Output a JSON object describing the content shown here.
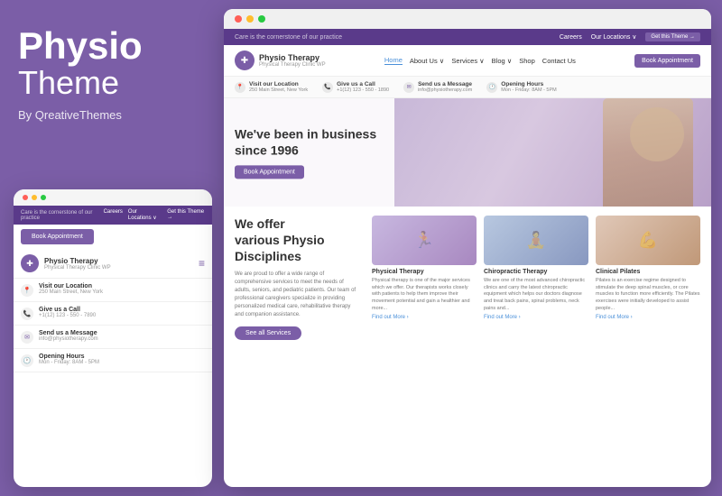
{
  "left": {
    "title_bold": "Physio",
    "title_light": "Theme",
    "subtitle": "By QreativeThemes"
  },
  "mobile": {
    "tagline": "Care is the cornerstone of our practice",
    "nav_links": [
      "Careers",
      "Our Locations ∨",
      "Get this Theme →"
    ],
    "book_btn": "Book Appointment",
    "brand_name": "Physio Therapy",
    "brand_sub": "Physical Therapy Clinic WP",
    "info_items": [
      {
        "label": "Visit our Location",
        "value": "250 Main Street, New York"
      },
      {
        "label": "Give us a Call",
        "value": "+1(12) 123 - 550 - 7890"
      },
      {
        "label": "Send us a Message",
        "value": "info@physiotherapy.com"
      },
      {
        "label": "Opening Hours",
        "value": "Mon - Friday: 8AM - 5PM"
      }
    ]
  },
  "desktop": {
    "top_nav": {
      "tagline": "Care is the cornerstone of our practice",
      "links": [
        "Careers",
        "Our Locations ∨",
        "Get this Theme →"
      ]
    },
    "header": {
      "brand_name": "Physio Therapy",
      "brand_sub": "Physical Therapy Clinic WP",
      "menu": [
        "Home",
        "About Us ∨",
        "Services ∨",
        "Blog ∨",
        "Shop",
        "Contact Us"
      ],
      "active": "Home",
      "book_btn": "Book Appointment"
    },
    "info_bar": [
      {
        "icon": "📍",
        "label": "Visit our Location",
        "value": "250 Main Street, New York"
      },
      {
        "icon": "📞",
        "label": "Give us a Call",
        "value": "+1(12) 123 - 550 - 1890"
      },
      {
        "icon": "✉",
        "label": "Send us a Message",
        "value": "info@physiotherapy.com"
      },
      {
        "icon": "🕐",
        "label": "Opening Hours",
        "value": "Mon - Friday: 8AM - 5PM"
      }
    ],
    "hero": {
      "headline_line1": "We've been in business",
      "headline_line2": "since 1996",
      "book_btn": "Book Appointment"
    },
    "offer_section": {
      "heading_line1": "We offer",
      "heading_line2": "various Physio",
      "heading_line3": "Disciplines",
      "description": "We are proud to offer a wide range of comprehensive services to meet the needs of adults, seniors, and pediatric patients. Our team of professional caregivers specialize in providing personalized medical care, rehabilitative therapy and companion assistance.",
      "see_all_btn": "See all Services"
    },
    "cards": [
      {
        "title": "Physical Therapy",
        "description": "Physical therapy is one of the major services which we offer. Our therapists works closely with patients to help them improve their movement potential and gain a healthier and more...",
        "link": "Find out More ›"
      },
      {
        "title": "Chiropractic Therapy",
        "description": "We are one of the most advanced chiropractic clinics and carry the latest chiropractic equipment which helps our doctors diagnose and treat back pains, spinal problems, neck pains and...",
        "link": "Find out More ›"
      },
      {
        "title": "Clinical Pilates",
        "description": "Pilates is an exercise regime designed to stimulate the deep spinal muscles, or core muscles to function more efficiently. The Pilates exercises were initially developed to assist people...",
        "link": "Find out More ›"
      }
    ]
  },
  "colors": {
    "purple": "#7b5ea7",
    "dark_purple": "#5a3a8a",
    "link_blue": "#4a90d9"
  }
}
